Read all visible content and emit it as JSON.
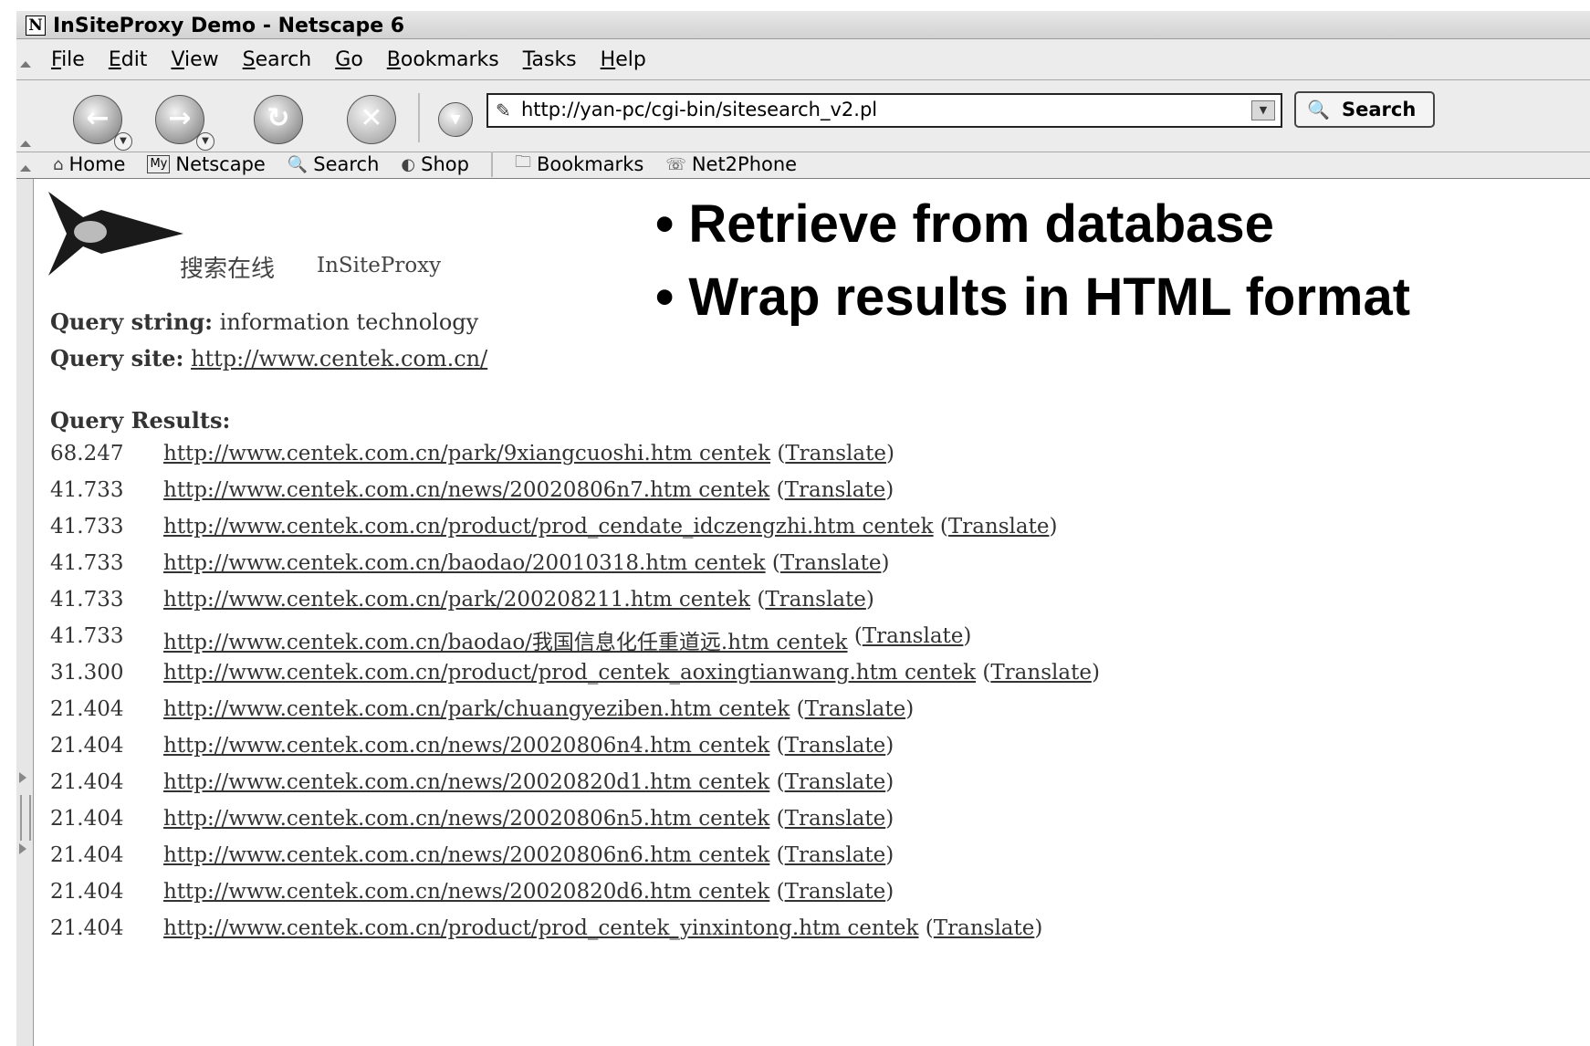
{
  "window": {
    "title": "InSiteProxy Demo - Netscape 6",
    "logo_letter": "N"
  },
  "menu": [
    "File",
    "Edit",
    "View",
    "Search",
    "Go",
    "Bookmarks",
    "Tasks",
    "Help"
  ],
  "navigation": {
    "url": "http://yan-pc/cgi-bin/sitesearch_v2.pl",
    "search_label": "Search"
  },
  "personal_toolbar": {
    "home": "Home",
    "my_badge": "My",
    "netscape": "Netscape",
    "search": "Search",
    "shop": "Shop",
    "bookmarks": "Bookmarks",
    "net2phone": "Net2Phone"
  },
  "page": {
    "logo_cn": "搜索在线",
    "logo_en": "InSiteProxy",
    "query_string_label": "Query string:",
    "query_string": "information technology",
    "query_site_label": "Query site:",
    "query_site": "http://www.centek.com.cn/",
    "results_label": "Query Results:",
    "translate_label": "Translate",
    "results": [
      {
        "score": "68.247",
        "link": "http://www.centek.com.cn/park/9xiangcuoshi.htm centek"
      },
      {
        "score": "41.733",
        "link": "http://www.centek.com.cn/news/20020806n7.htm centek"
      },
      {
        "score": "41.733",
        "link": "http://www.centek.com.cn/product/prod_cendate_idczengzhi.htm centek"
      },
      {
        "score": "41.733",
        "link": "http://www.centek.com.cn/baodao/20010318.htm centek"
      },
      {
        "score": "41.733",
        "link": "http://www.centek.com.cn/park/200208211.htm centek"
      },
      {
        "score": "41.733",
        "link": "http://www.centek.com.cn/baodao/我国信息化任重道远.htm centek"
      },
      {
        "score": "31.300",
        "link": "http://www.centek.com.cn/product/prod_centek_aoxingtianwang.htm centek"
      },
      {
        "score": "21.404",
        "link": "http://www.centek.com.cn/park/chuangyeziben.htm centek"
      },
      {
        "score": "21.404",
        "link": "http://www.centek.com.cn/news/20020806n4.htm centek"
      },
      {
        "score": "21.404",
        "link": "http://www.centek.com.cn/news/20020820d1.htm centek"
      },
      {
        "score": "21.404",
        "link": "http://www.centek.com.cn/news/20020806n5.htm centek"
      },
      {
        "score": "21.404",
        "link": "http://www.centek.com.cn/news/20020806n6.htm centek"
      },
      {
        "score": "21.404",
        "link": "http://www.centek.com.cn/news/20020820d6.htm centek"
      },
      {
        "score": "21.404",
        "link": "http://www.centek.com.cn/product/prod_centek_yinxintong.htm centek"
      }
    ]
  },
  "slide": {
    "bullet_1": "• Retrieve from database",
    "bullet_2": "• Wrap results in HTML format"
  },
  "icons": {
    "back": "back-arrow-icon",
    "forward": "forward-arrow-icon",
    "reload": "reload-icon",
    "stop": "stop-icon",
    "search": "magnifier-icon"
  }
}
